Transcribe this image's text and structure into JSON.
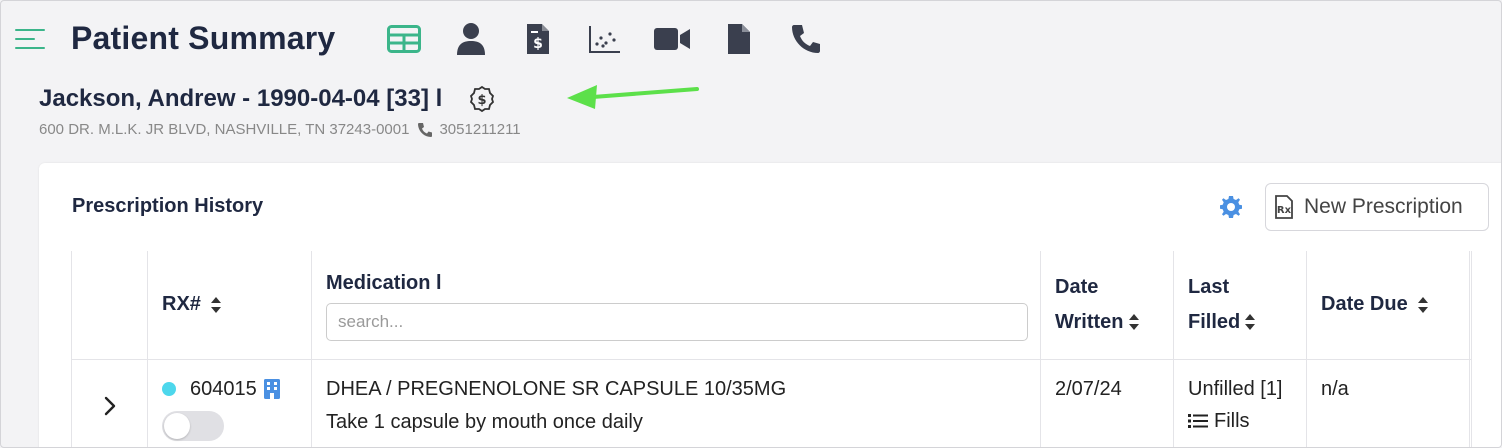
{
  "header": {
    "title": "Patient Summary",
    "icons": [
      "table-icon",
      "person-icon",
      "bill-dollar-icon",
      "scatter-chart-icon",
      "video-icon",
      "document-icon",
      "phone-icon"
    ]
  },
  "patient": {
    "name_line": "Jackson, Andrew - 1990-04-04 [33] l",
    "address": "600 DR. M.L.K. JR BLVD, NASHVILLE, TN 37243-0001",
    "phone": "3051211211"
  },
  "prescriptions": {
    "title": "Prescription History",
    "new_button": "New Prescription",
    "columns": {
      "rx": "RX#",
      "medication": "Medication l",
      "date_written_1": "Date",
      "date_written_2": "Written",
      "last_filled_1": "Last",
      "last_filled_2": "Filled",
      "date_due": "Date Due"
    },
    "search_placeholder": "search...",
    "rows": [
      {
        "rx": "604015",
        "medication": "DHEA / PREGNENOLONE SR CAPSULE 10/35MG",
        "sig": "Take 1 capsule by mouth once daily",
        "date_written": "2/07/24",
        "last_filled": "Unfilled [1]",
        "fills_link": "Fills",
        "date_due": "n/a"
      }
    ]
  },
  "colors": {
    "accent_green": "#3bb58a",
    "navy": "#1f2841",
    "icon_dark": "#3a3f4e",
    "status_dot": "#4dd7ec",
    "gear_blue": "#4a90e2",
    "annotation_arrow": "#5ce04a"
  }
}
